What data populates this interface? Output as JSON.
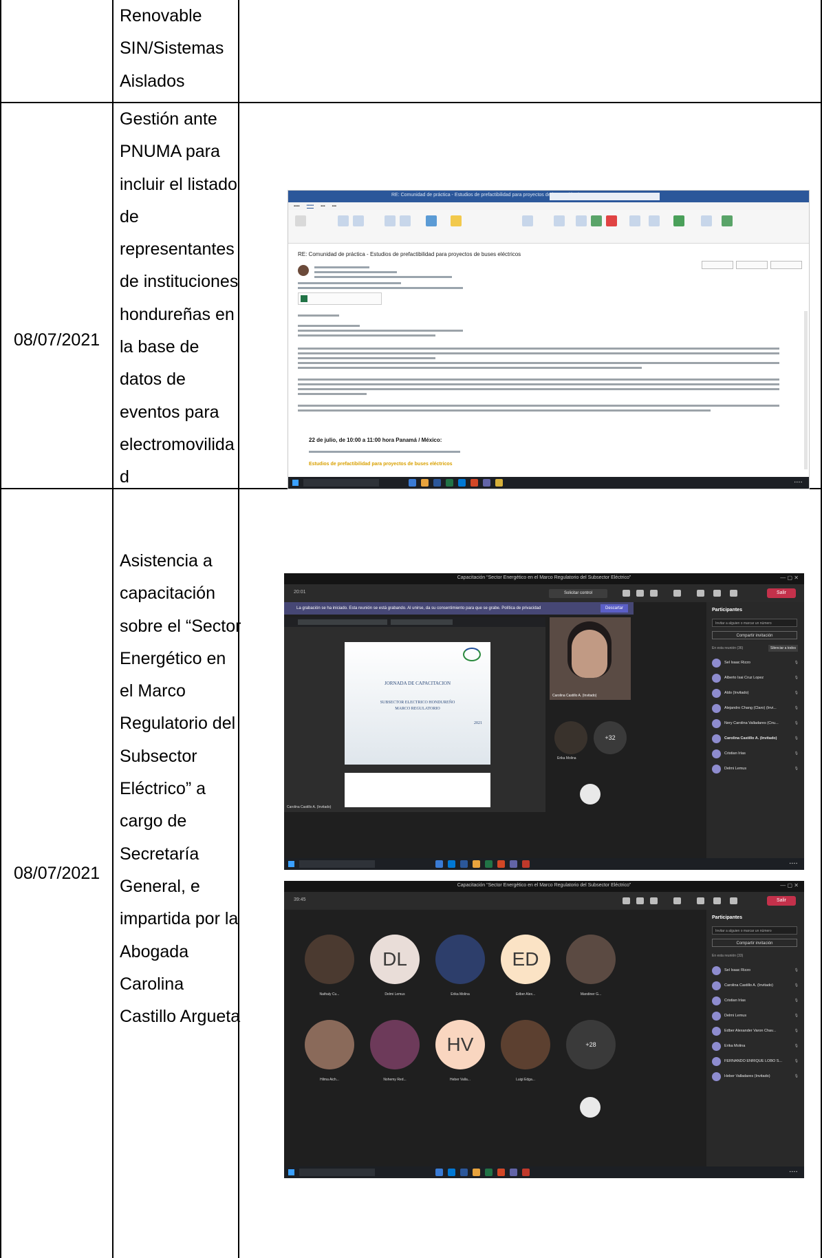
{
  "table": {
    "rows": [
      {
        "date": "",
        "description_lines": [
          "Renovable",
          "SIN/Sistemas",
          "Aislados"
        ]
      },
      {
        "date": "08/07/2021",
        "description_lines": [
          "Gestión ante",
          "PNUMA para",
          "incluir el listado",
          "de",
          "representantes",
          "de instituciones",
          "hondureñas en",
          "la base de",
          "datos de",
          "eventos para",
          "electromovilida",
          "d"
        ]
      },
      {
        "date": "08/07/2021",
        "description_lines": [
          "Asistencia a",
          "capacitación",
          "sobre el “Sector",
          "Energético en",
          "el Marco",
          "Regulatorio del",
          "Subsector",
          "Eléctrico” a",
          "cargo de",
          "Secretaría",
          "General, e",
          "impartida por la",
          "Abogada",
          "Carolina",
          "Castillo Argueta"
        ]
      }
    ]
  },
  "outlook_screenshot": {
    "subject": "RE: Comunidad de práctica - Estudios de prefactibilidad para proyectos de buses eléctricos",
    "date_heading": "22 de julio, de 10:00 a 11:00 hora Panamá / México:",
    "highlight": "Estudios de prefactibilidad para proyectos de buses eléctricos"
  },
  "teams_screenshot_1": {
    "window_title": "Capacitación “Sector Energético en el Marco Regulatorio del Subsector Eléctrico”",
    "clock": "20:01",
    "request_control": "Solicitar control",
    "leave": "Salir",
    "banner": "La grabación se ha iniciado. Esta reunión se está grabando. Al unirse, da su consentimiento para que se grabe. Política de privacidad",
    "banner_button": "Descartar",
    "slide_title": "JORNADA DE CAPACITACION",
    "slide_subtitle_1": "SUBSECTOR ELECTRICO HONDUREÑO",
    "slide_subtitle_2": "MARCO REGULATORIO",
    "slide_year": "2021",
    "speaker_name": "Carolina Castillo A. (Invitado)",
    "presenter_caption": "Carolina Castillo A. (Invitado)",
    "small_tile_name": "Erika Molina",
    "overflow_count": "+32",
    "panel_title": "Participantes",
    "panel_search": "Invitar a alguien o marcar un número",
    "panel_share": "Compartir invitación",
    "section_label": "En esta reunión (36)",
    "mute_all": "Silenciar a todos",
    "participants": [
      "Sel Isaac Rizzo",
      "Alberto Isai Cruz Lopez",
      "Aldo (Invitado)",
      "Alejandro Chang (Claro) (Invi...",
      "Nery Carolina Valladares (Cnu...",
      "Carolina Castillo A. (Invitado)",
      "Cristian Irías",
      "Delmi Lemus"
    ]
  },
  "teams_screenshot_2": {
    "window_title": "Capacitación “Sector Energético en el Marco Regulatorio del Subsector Eléctrico”",
    "clock": "39:45",
    "leave": "Salir",
    "panel_title": "Participantes",
    "panel_search": "Invitar a alguien o marcar un número",
    "panel_share": "Compartir invitación",
    "section_label": "En esta reunión (33)",
    "tiles": [
      {
        "initials": "",
        "name": "Nathaly Cu..."
      },
      {
        "initials": "DL",
        "name": "Delmi Lemus"
      },
      {
        "initials": "",
        "name": "Erika Molina"
      },
      {
        "initials": "ED",
        "name": "Edber Alex..."
      },
      {
        "initials": "",
        "name": "Mandiner G..."
      },
      {
        "initials": "",
        "name": "Hilma Aich..."
      },
      {
        "initials": "",
        "name": "Nohemy Red..."
      },
      {
        "initials": "HV",
        "name": "Heber Valla..."
      },
      {
        "initials": "",
        "name": "Luigi Edga..."
      },
      {
        "initials": "+28",
        "name": ""
      }
    ],
    "participants": [
      "Sel Isaac Rizzo",
      "Carolina Castillo A. (Invitado)",
      "Cristian Irías",
      "Delmi Lemus",
      "Edber Alexander Varon Chav...",
      "Erika Molina",
      "FERNANDO ENRIQUE LOBO S...",
      "Heber Valladares (Invitado)"
    ]
  }
}
